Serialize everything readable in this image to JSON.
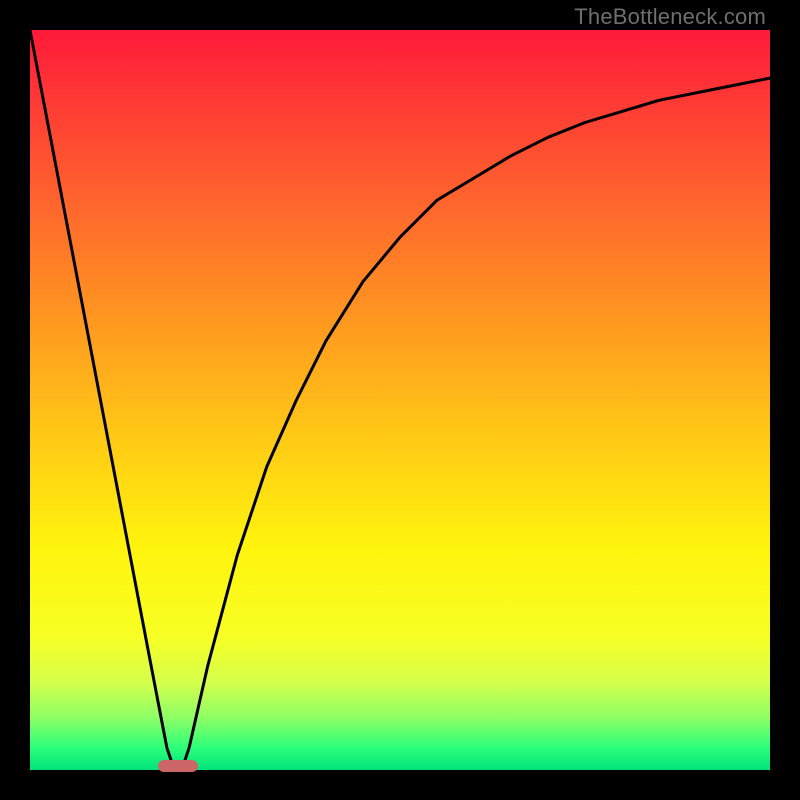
{
  "watermark": "TheBottleneck.com",
  "chart_data": {
    "type": "line",
    "title": "",
    "xlabel": "",
    "ylabel": "",
    "xlim": [
      0,
      1
    ],
    "ylim": [
      0,
      1
    ],
    "series": [
      {
        "name": "curve",
        "x": [
          0.0,
          0.04,
          0.08,
          0.12,
          0.16,
          0.185,
          0.195,
          0.205,
          0.215,
          0.24,
          0.28,
          0.32,
          0.36,
          0.4,
          0.45,
          0.5,
          0.55,
          0.6,
          0.65,
          0.7,
          0.75,
          0.8,
          0.85,
          0.9,
          0.95,
          1.0
        ],
        "values": [
          1.0,
          0.79,
          0.58,
          0.37,
          0.16,
          0.03,
          0.0,
          0.0,
          0.03,
          0.14,
          0.29,
          0.41,
          0.5,
          0.58,
          0.66,
          0.72,
          0.77,
          0.8,
          0.83,
          0.855,
          0.875,
          0.89,
          0.905,
          0.915,
          0.925,
          0.935
        ]
      }
    ],
    "marker": {
      "x": 0.2,
      "y": 0.0,
      "color": "#cc6666"
    },
    "gradient_stops": [
      {
        "pos": 0.0,
        "color": "#ff1a3a"
      },
      {
        "pos": 0.55,
        "color": "#ffc915"
      },
      {
        "pos": 0.82,
        "color": "#f7ff24"
      },
      {
        "pos": 1.0,
        "color": "#00e27a"
      }
    ]
  }
}
